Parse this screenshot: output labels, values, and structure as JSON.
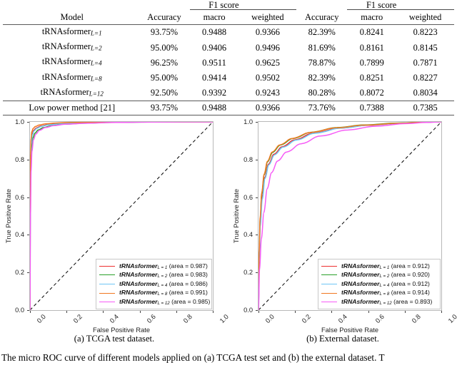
{
  "table": {
    "group_headers": [
      {
        "label": "",
        "span": 1
      },
      {
        "label": "",
        "span": 1
      },
      {
        "label": "F1 score",
        "span": 2
      },
      {
        "label": "",
        "span": 1
      },
      {
        "label": "F1 score",
        "span": 2
      }
    ],
    "columns": [
      "Model",
      "Accuracy",
      "macro",
      "weighted",
      "Accuracy",
      "macro",
      "weighted"
    ],
    "rows": [
      {
        "model": "tRNAsformer",
        "sub": "L=1",
        "cells": [
          "93.75%",
          "0.9488",
          "0.9366",
          "82.39%",
          "0.8241",
          "0.8223"
        ]
      },
      {
        "model": "tRNAsformer",
        "sub": "L=2",
        "cells": [
          "95.00%",
          "0.9406",
          "0.9496",
          "81.69%",
          "0.8161",
          "0.8145"
        ]
      },
      {
        "model": "tRNAsformer",
        "sub": "L=4",
        "cells": [
          "96.25%",
          "0.9511",
          "0.9625",
          "78.87%",
          "0.7899",
          "0.7871"
        ]
      },
      {
        "model": "tRNAsformer",
        "sub": "L=8",
        "cells": [
          "95.00%",
          "0.9414",
          "0.9502",
          "82.39%",
          "0.8251",
          "0.8227"
        ]
      },
      {
        "model": "tRNAsformer",
        "sub": "L=12",
        "cells": [
          "92.50%",
          "0.9392",
          "0.9243",
          "80.28%",
          "0.8072",
          "0.8034"
        ]
      }
    ],
    "footer_row": {
      "model": "Low power method [21]",
      "sub": "",
      "cells": [
        "93.75%",
        "0.9488",
        "0.9366",
        "73.76%",
        "0.7388",
        "0.7385"
      ]
    }
  },
  "figure": {
    "subcaption_a": "(a) TCGA test dataset.",
    "subcaption_b": "(b) External dataset.",
    "main_caption": "The micro ROC curve of different models applied on (a) TCGA test set and (b) the external dataset. T"
  },
  "chart_data": [
    {
      "type": "line",
      "id": "tcga-roc",
      "title": "(a) TCGA test dataset.",
      "xlabel": "False Positive Rate",
      "ylabel": "True Positive Rate",
      "xlim": [
        0.0,
        1.0
      ],
      "ylim": [
        0.0,
        1.0
      ],
      "xticks": [
        "0.0",
        "0.2",
        "0.4",
        "0.6",
        "0.8",
        "1.0"
      ],
      "yticks": [
        "0.0",
        "0.2",
        "0.4",
        "0.6",
        "0.8",
        "1.0"
      ],
      "grid": false,
      "legend_position": "lower right",
      "diagonal_reference": true,
      "series": [
        {
          "name": "tRNAsformer",
          "sub": "L = 1",
          "area": "0.987",
          "color": "#ed2f2f",
          "legend": "tRNAsformer (area = 0.987)",
          "x": [
            0,
            0.002,
            0.004,
            0.007,
            0.012,
            0.02,
            0.035,
            0.06,
            0.1,
            0.16,
            0.25,
            0.4,
            0.6,
            0.8,
            1.0
          ],
          "y": [
            0,
            0.6,
            0.8,
            0.895,
            0.935,
            0.955,
            0.968,
            0.978,
            0.986,
            0.991,
            0.995,
            0.998,
            0.999,
            1.0,
            1.0
          ]
        },
        {
          "name": "tRNAsformer",
          "sub": "L = 2",
          "area": "0.983",
          "color": "#2aa02a",
          "legend": "tRNAsformer (area = 0.983)",
          "x": [
            0,
            0.002,
            0.005,
            0.009,
            0.016,
            0.027,
            0.045,
            0.075,
            0.12,
            0.19,
            0.3,
            0.45,
            0.65,
            0.82,
            1.0
          ],
          "y": [
            0,
            0.55,
            0.77,
            0.865,
            0.915,
            0.94,
            0.957,
            0.97,
            0.98,
            0.988,
            0.993,
            0.997,
            0.999,
            1.0,
            1.0
          ]
        },
        {
          "name": "tRNAsformer",
          "sub": "L = 4",
          "area": "0.986",
          "color": "#6ec6f5",
          "legend": "tRNAsformer (area = 0.986)",
          "x": [
            0,
            0.002,
            0.004,
            0.008,
            0.013,
            0.022,
            0.038,
            0.065,
            0.105,
            0.17,
            0.27,
            0.42,
            0.62,
            0.8,
            1.0
          ],
          "y": [
            0,
            0.58,
            0.79,
            0.885,
            0.93,
            0.952,
            0.966,
            0.977,
            0.985,
            0.99,
            0.995,
            0.998,
            0.999,
            1.0,
            1.0
          ]
        },
        {
          "name": "tRNAsformer",
          "sub": "L = 8",
          "area": "0.991",
          "color": "#f07820",
          "legend": "tRNAsformer (area = 0.991)",
          "x": [
            0,
            0.0015,
            0.003,
            0.006,
            0.01,
            0.017,
            0.03,
            0.052,
            0.088,
            0.14,
            0.22,
            0.36,
            0.56,
            0.78,
            1.0
          ],
          "y": [
            0,
            0.63,
            0.83,
            0.912,
            0.948,
            0.965,
            0.976,
            0.984,
            0.99,
            0.994,
            0.997,
            0.999,
            1.0,
            1.0,
            1.0
          ]
        },
        {
          "name": "tRNAsformer",
          "sub": "L = 12",
          "area": "0.985",
          "color": "#f65bf6",
          "legend": "tRNAsformer (area = 0.985)",
          "x": [
            0,
            0.003,
            0.006,
            0.011,
            0.019,
            0.032,
            0.052,
            0.085,
            0.13,
            0.2,
            0.31,
            0.47,
            0.67,
            0.85,
            1.0
          ],
          "y": [
            0,
            0.52,
            0.74,
            0.845,
            0.905,
            0.935,
            0.955,
            0.97,
            0.98,
            0.988,
            0.993,
            0.997,
            0.999,
            1.0,
            1.0
          ]
        }
      ]
    },
    {
      "type": "line",
      "id": "external-roc",
      "title": "(b) External dataset.",
      "xlabel": "False Positive Rate",
      "ylabel": "True Positive Rate",
      "xlim": [
        0.0,
        1.0
      ],
      "ylim": [
        0.0,
        1.0
      ],
      "xticks": [
        "0.0",
        "0.2",
        "0.4",
        "0.6",
        "0.8",
        "1.0"
      ],
      "yticks": [
        "0.0",
        "0.2",
        "0.4",
        "0.6",
        "0.8",
        "1.0"
      ],
      "grid": false,
      "legend_position": "lower right",
      "diagonal_reference": true,
      "series": [
        {
          "name": "tRNAsformer",
          "sub": "L = 1",
          "area": "0.912",
          "color": "#ed2f2f",
          "legend": "tRNAsformer (area = 0.912)",
          "x": [
            0,
            0.004,
            0.01,
            0.02,
            0.035,
            0.055,
            0.085,
            0.13,
            0.2,
            0.3,
            0.45,
            0.6,
            0.78,
            0.9,
            1.0
          ],
          "y": [
            0,
            0.29,
            0.46,
            0.6,
            0.705,
            0.775,
            0.828,
            0.868,
            0.905,
            0.94,
            0.967,
            0.982,
            0.993,
            0.998,
            1.0
          ]
        },
        {
          "name": "tRNAsformer",
          "sub": "L = 2",
          "area": "0.920",
          "color": "#2aa02a",
          "legend": "tRNAsformer (area = 0.920)",
          "x": [
            0,
            0.004,
            0.009,
            0.018,
            0.032,
            0.05,
            0.078,
            0.12,
            0.19,
            0.29,
            0.43,
            0.58,
            0.76,
            0.89,
            1.0
          ],
          "y": [
            0,
            0.3,
            0.48,
            0.62,
            0.72,
            0.788,
            0.838,
            0.877,
            0.912,
            0.945,
            0.97,
            0.984,
            0.994,
            0.998,
            1.0
          ]
        },
        {
          "name": "tRNAsformer",
          "sub": "L = 4",
          "area": "0.912",
          "color": "#6ec6f5",
          "legend": "tRNAsformer (area = 0.912)",
          "x": [
            0,
            0.004,
            0.01,
            0.021,
            0.036,
            0.057,
            0.088,
            0.135,
            0.21,
            0.31,
            0.46,
            0.61,
            0.79,
            0.91,
            1.0
          ],
          "y": [
            0,
            0.28,
            0.45,
            0.59,
            0.7,
            0.772,
            0.825,
            0.866,
            0.904,
            0.94,
            0.968,
            0.983,
            0.994,
            0.998,
            1.0
          ]
        },
        {
          "name": "tRNAsformer",
          "sub": "L = 8",
          "area": "0.914",
          "color": "#f07820",
          "legend": "tRNAsformer (area = 0.914)",
          "x": [
            0,
            0.0035,
            0.009,
            0.018,
            0.031,
            0.049,
            0.076,
            0.118,
            0.185,
            0.285,
            0.43,
            0.58,
            0.77,
            0.9,
            1.0
          ],
          "y": [
            0,
            0.31,
            0.49,
            0.625,
            0.722,
            0.79,
            0.84,
            0.878,
            0.912,
            0.944,
            0.969,
            0.983,
            0.993,
            0.998,
            1.0
          ]
        },
        {
          "name": "tRNAsformer",
          "sub": "L = 12",
          "area": "0.893",
          "color": "#f65bf6",
          "legend": "tRNAsformer (area = 0.893)",
          "x": [
            0,
            0.006,
            0.016,
            0.03,
            0.048,
            0.072,
            0.105,
            0.155,
            0.235,
            0.34,
            0.49,
            0.64,
            0.81,
            0.92,
            1.0
          ],
          "y": [
            0,
            0.22,
            0.38,
            0.52,
            0.645,
            0.73,
            0.792,
            0.84,
            0.884,
            0.925,
            0.957,
            0.977,
            0.991,
            0.997,
            1.0
          ]
        }
      ]
    }
  ]
}
